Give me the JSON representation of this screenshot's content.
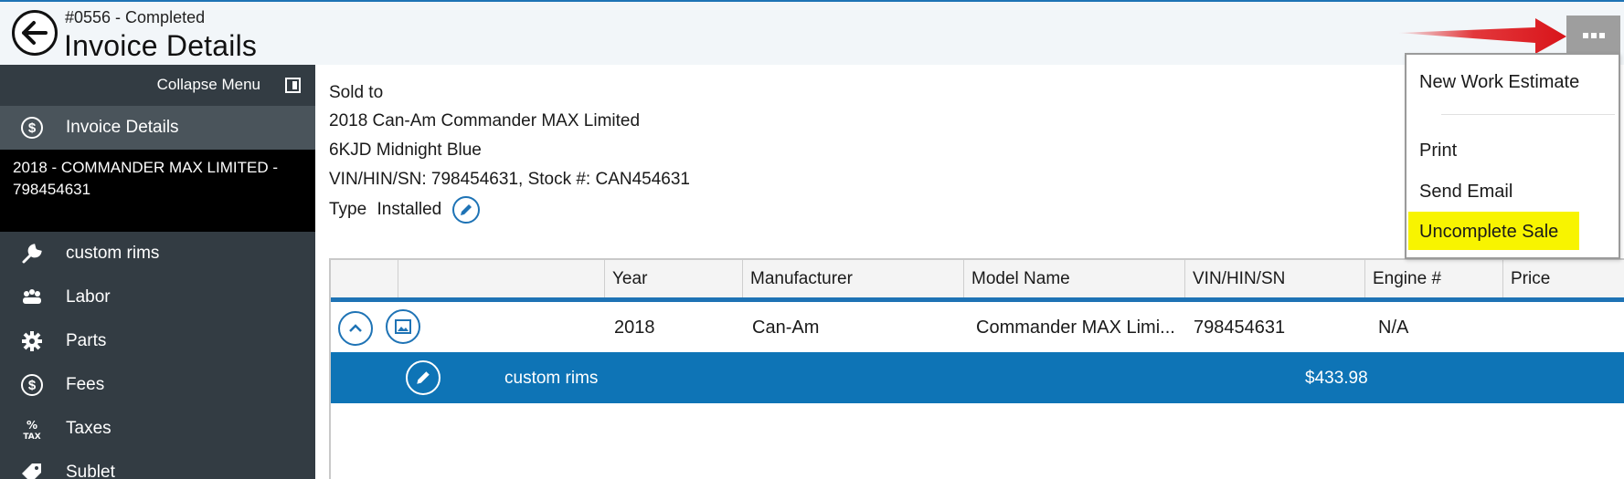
{
  "header": {
    "subtitle": "#0556 - Completed",
    "title": "Invoice Details",
    "back_icon": "arrow-left-icon",
    "more_icon": "ellipsis-icon"
  },
  "sidebar": {
    "collapse_label": "Collapse Menu",
    "active_item": {
      "label": "Invoice Details",
      "icon": "dollar-coin-icon"
    },
    "vehicle": "2018 - COMMANDER MAX LIMITED - 798454631",
    "items": [
      {
        "label": "custom rims",
        "icon": "wrench-icon"
      },
      {
        "label": "Labor",
        "icon": "workers-icon"
      },
      {
        "label": "Parts",
        "icon": "gear-icon"
      },
      {
        "label": "Fees",
        "icon": "dollar-coin-icon"
      },
      {
        "label": "Taxes",
        "icon": "tax-icon"
      },
      {
        "label": "Sublet",
        "icon": "tag-icon"
      }
    ]
  },
  "info": {
    "sold_to": "Sold to",
    "vehicle_name": "2018 Can-Am Commander MAX Limited",
    "color": "6KJD Midnight Blue",
    "vin_stock": "VIN/HIN/SN: 798454631, Stock #: CAN454631",
    "type_label": "Type",
    "type_value": "Installed"
  },
  "table": {
    "columns": [
      "Year",
      "Manufacturer",
      "Model Name",
      "VIN/HIN/SN",
      "Engine #",
      "Price"
    ],
    "row": {
      "year": "2018",
      "manufacturer": "Can-Am",
      "model": "Commander MAX Limi...",
      "vin": "798454631",
      "engine": "N/A"
    },
    "subrow": {
      "label": "custom rims",
      "amount": "$433.98"
    }
  },
  "menu": {
    "items": [
      "New Work Estimate",
      "Print",
      "Send Email",
      "Uncomplete Sale"
    ],
    "highlighted": "Uncomplete Sale"
  },
  "colors": {
    "accent": "#1e73b5",
    "row_selected": "#0e74b6",
    "sidebar_bg": "#333c43",
    "highlight": "#f8f400",
    "annotation_arrow": "#e0161a"
  }
}
